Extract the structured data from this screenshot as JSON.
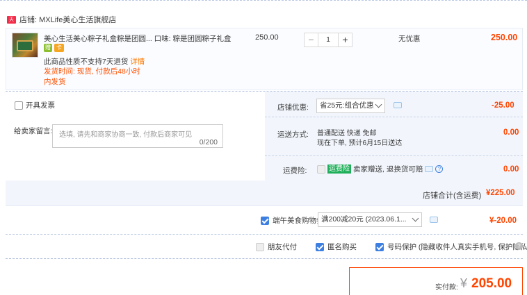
{
  "shop": {
    "icon_text": "天猫",
    "label": "店铺: MXLife美心生活旗舰店"
  },
  "item": {
    "title": "美心生活美心粽子礼盒粽是团圆...  口味: 粽是团圆粽子礼盒",
    "badges": [
      "赠",
      "卡"
    ],
    "return_note": "此商品性质不支持7天退货 ",
    "detail_link": "详情",
    "ship_time": "发货时间: 现货, 付款后48小时",
    "ship_place": "内发货",
    "unit_price": "250.00",
    "quantity": "1",
    "discount": "无优惠",
    "subtotal": "250.00"
  },
  "stepper": {
    "minus": "−",
    "plus": "+"
  },
  "invoice": {
    "label": "开具发票"
  },
  "message": {
    "label": "给卖家留言:",
    "placeholder": "选填, 请先和商家协商一致, 付款后商家可见",
    "count": "0/200"
  },
  "shop_discount": {
    "label": "店铺优惠:",
    "selected": "省25元:组合优惠",
    "value": "-25.00"
  },
  "shipping": {
    "label": "运送方式:",
    "line1": "普通配送 快递 免邮",
    "line2": "现在下单, 预计6月15日送达",
    "value": "0.00"
  },
  "insurance": {
    "label": "运费险:",
    "tag": "运费险",
    "text": "卖家赠送, 退换货可赔",
    "value": "0.00"
  },
  "shop_total": {
    "label": "店铺合计(含运费)",
    "value": "¥225.00"
  },
  "coupon": {
    "label": "端午美食购物券",
    "selected": "满200减20元 (2023.06.1...",
    "value": "¥-20.00"
  },
  "options": {
    "friend_pay": "朋友代付",
    "anonymous": "匿名购买",
    "privacy": "号码保护 (隐藏收件人真实手机号, 保护隐私)"
  },
  "payment": {
    "label": "实付款:",
    "currency": "¥",
    "amount": "205.00"
  },
  "colors": {
    "accent_red": "#ff4400",
    "link_blue": "#3d7fe0",
    "panel_bg": "#f2f6fc"
  }
}
